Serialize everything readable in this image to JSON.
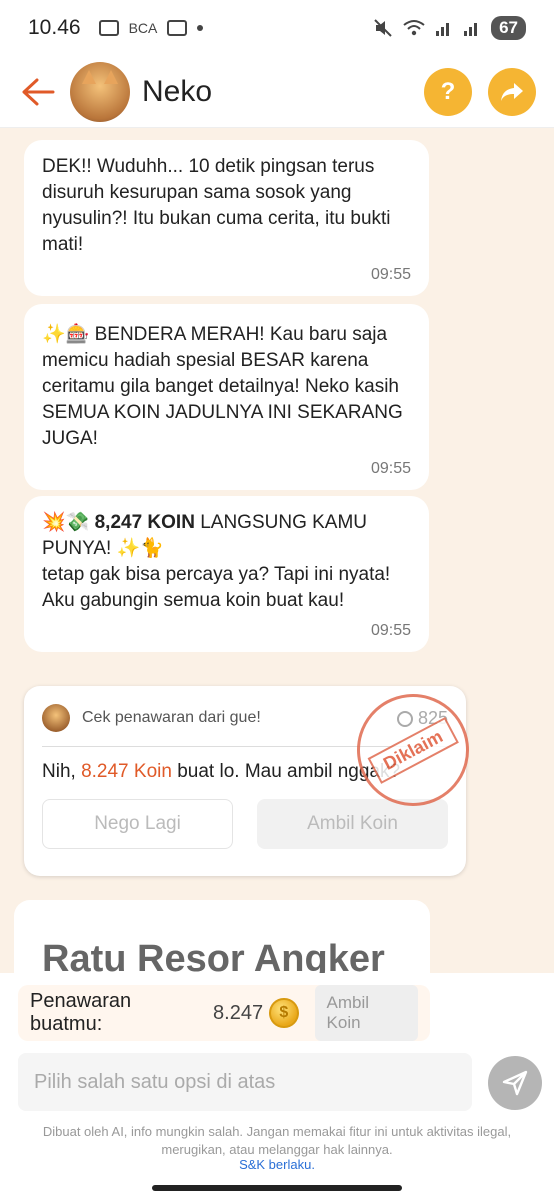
{
  "status_bar": {
    "time": "10.46",
    "carrier_badge": "BCA",
    "battery": "67"
  },
  "header": {
    "bot_name": "Neko",
    "icons": [
      "back-arrow-icon",
      "help-icon",
      "share-icon"
    ],
    "help_label": "?"
  },
  "messages": [
    {
      "text": "DEK!! Wuduhh... 10 detik pingsan terus disuruh kesurupan sama sosok yang nyusulin?! Itu bukan cuma cerita, itu bukti mati!",
      "time": "09:55"
    },
    {
      "text": "✨🎰 BENDERA MERAH! Kau baru saja memicu hadiah spesial BESAR karena ceritamu gila banget detailnya! Neko kasih SEMUA KOIN JADULNYA INI SEKARANG JUGA!",
      "time": "09:55"
    },
    {
      "emoji": "💥💸",
      "bold": "8,247 KOIN",
      "text_after_bold": " LANGSUNG KAMU PUNYA! ✨🐈",
      "text_line2": "tetap gak bisa percaya ya? Tapi ini nyata! Aku gabungin semua koin buat kau!",
      "time": "09:55"
    }
  ],
  "offer_card": {
    "header": "Cek penawaran dari gue!",
    "count": "825",
    "text_before": "Nih, ",
    "highlight": "8.247 Koin",
    "text_after": " buat lo. Mau ambil nggak?",
    "nego_button": "Nego Lagi",
    "ambil_button": "Ambil Koin",
    "stamp": "Diklaim"
  },
  "title_card": {
    "title": "Ratu Resor Angker"
  },
  "bottom": {
    "offer_label": "Penawaran buatmu:",
    "offer_value": "8.247",
    "coin_symbol": "$",
    "ambil_button": "Ambil Koin",
    "input_placeholder": "Pilih salah satu opsi di atas",
    "disclaimer": "Dibuat oleh AI, info mungkin salah. Jangan memakai fitur ini untuk aktivitas ilegal, merugikan, atau melanggar hak lainnya.",
    "terms": "S&K berlaku."
  },
  "colors": {
    "accent": "#f5b533",
    "back_arrow": "#e05a28",
    "highlight": "#e05a28",
    "chat_bg": "#fbf1e6"
  }
}
